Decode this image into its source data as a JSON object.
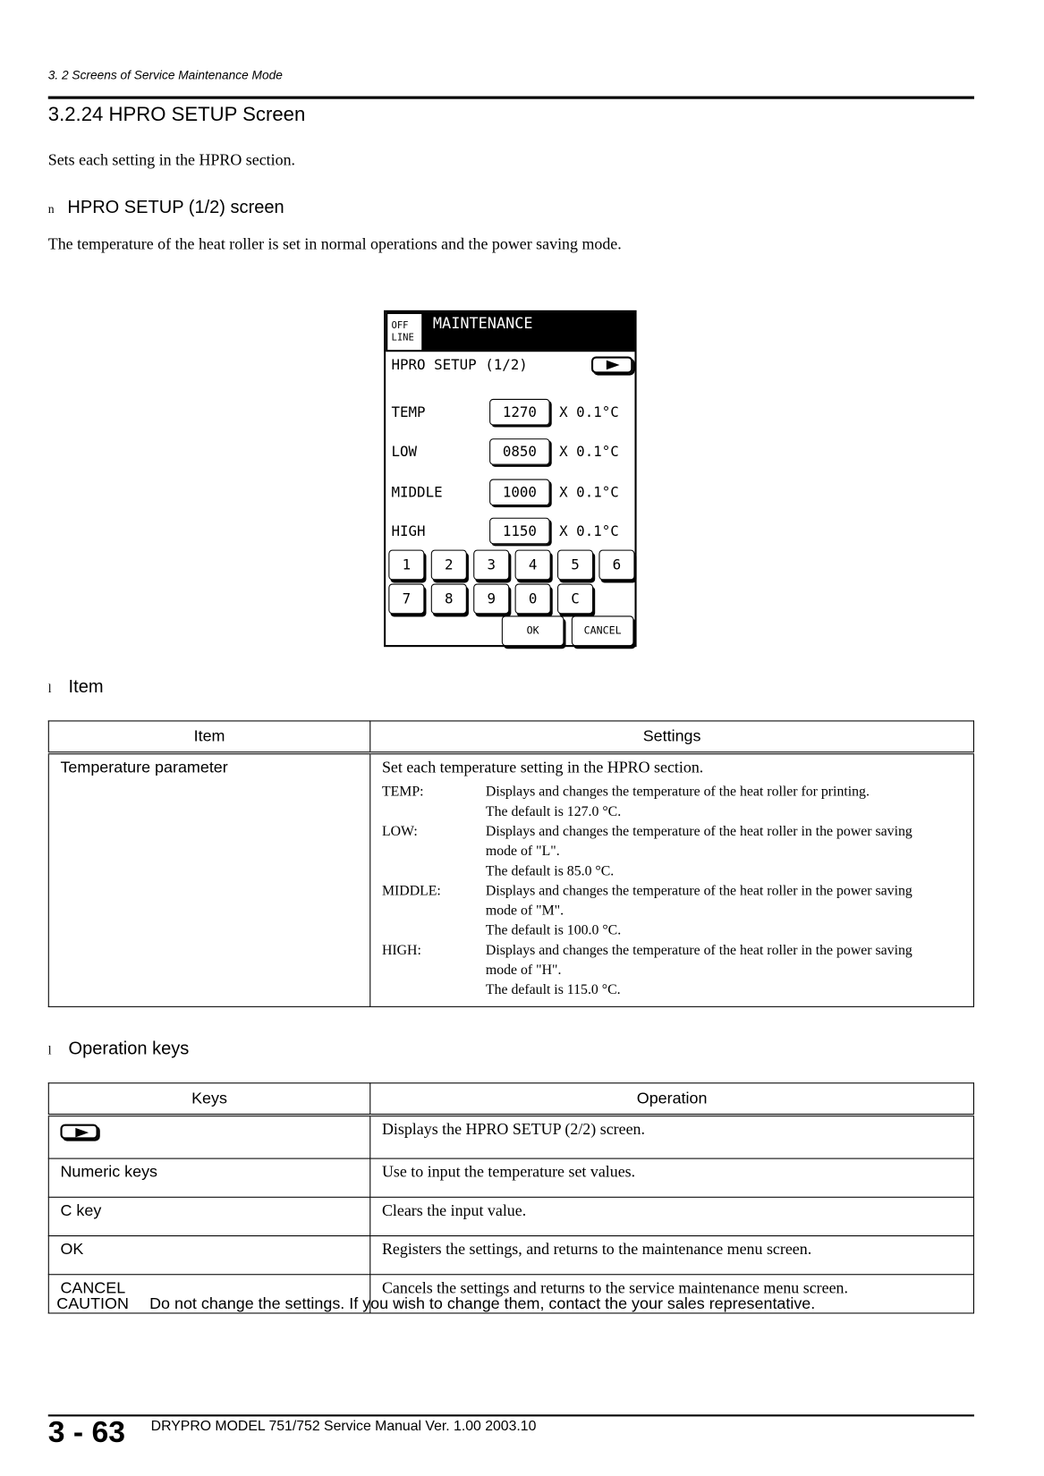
{
  "running_header": "3. 2 Screens of Service Maintenance Mode",
  "section_title": "3.2.24  HPRO SETUP Screen",
  "intro": "Sets each setting in the HPRO section.",
  "subsection": {
    "bullet": "n",
    "title": "HPRO SETUP (1/2) screen",
    "desc": "The temperature of the heat roller is set in normal operations and the power saving mode."
  },
  "screen": {
    "offline": [
      "OFF",
      "LINE"
    ],
    "header": "MAINTENANCE",
    "title": "HPRO SETUP (1/2)",
    "next_icon": "next-page-arrow-icon",
    "rows": [
      {
        "label": "TEMP",
        "value": "1270",
        "unit": "X 0.1°C"
      },
      {
        "label": "LOW",
        "value": "0850",
        "unit": "X 0.1°C"
      },
      {
        "label": "MIDDLE",
        "value": "1000",
        "unit": "X 0.1°C"
      },
      {
        "label": "HIGH",
        "value": "1150",
        "unit": "X 0.1°C"
      }
    ],
    "keys_row1": [
      "1",
      "2",
      "3",
      "4",
      "5",
      "6"
    ],
    "keys_row2": [
      "7",
      "8",
      "9",
      "0",
      "C"
    ],
    "ok": "OK",
    "cancel": "CANCEL"
  },
  "item_section": {
    "bullet": "l",
    "title": "Item",
    "headers": [
      "Item",
      "Settings"
    ],
    "row": {
      "item": "Temperature parameter",
      "lead": "Set each temperature setting in the HPRO section.",
      "entries": [
        {
          "key": "TEMP:",
          "lines": [
            "Displays and changes the temperature of the heat roller for printing.",
            "The default is 127.0 °C."
          ]
        },
        {
          "key": "LOW:",
          "lines": [
            "Displays and changes the temperature of the heat roller in the power saving",
            "mode of \"L\".",
            "The default is 85.0 °C."
          ]
        },
        {
          "key": "MIDDLE:",
          "lines": [
            "Displays and changes the temperature of the heat roller in the power saving",
            "mode of \"M\".",
            "The default is 100.0 °C."
          ]
        },
        {
          "key": "HIGH:",
          "lines": [
            "Displays and changes the temperature of the heat roller in the power saving",
            "mode of \"H\".",
            "The default is 115.0 °C."
          ]
        }
      ]
    }
  },
  "keys_section": {
    "bullet": "l",
    "title": "Operation keys",
    "headers": [
      "Keys",
      "Operation"
    ],
    "rows": [
      {
        "key": "",
        "icon": "next-page-arrow-icon",
        "op": "Displays the HPRO SETUP (2/2) screen."
      },
      {
        "key": "Numeric keys",
        "op": "Use to input the temperature set values."
      },
      {
        "key": "C key",
        "op": "Clears the input value."
      },
      {
        "key": "OK",
        "op": "Registers the settings, and returns to the maintenance menu screen."
      },
      {
        "key": "CANCEL",
        "op": "Cancels the settings and returns to the service maintenance menu screen."
      }
    ]
  },
  "caution": {
    "label": "CAUTION",
    "text": "Do not change the settings. If you wish to change them, contact the your sales representative."
  },
  "footer": {
    "page": "3 - 63",
    "manual": "DRYPRO MODEL 751/752 Service Manual Ver. 1.00 2003.10"
  }
}
